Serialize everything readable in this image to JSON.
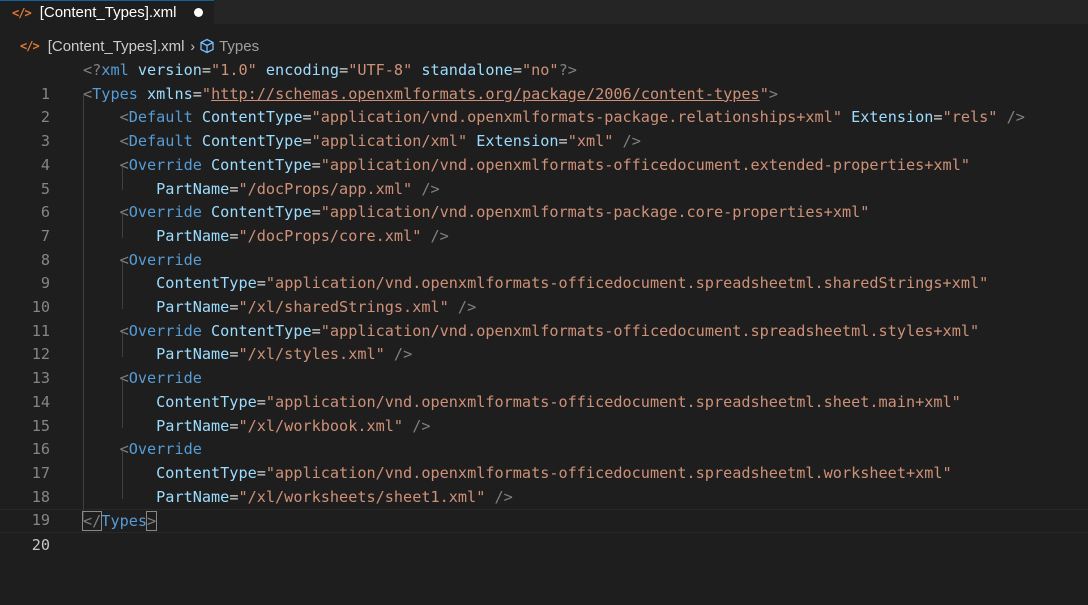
{
  "tab": {
    "icon": "</>",
    "label": "[Content_Types].xml"
  },
  "breadcrumb": {
    "icon": "</>",
    "file": "[Content_Types].xml",
    "chevron": "›",
    "symbol": "Types"
  },
  "editor": {
    "current_line": 20,
    "line_numbers": [
      "1",
      "2",
      "3",
      "4",
      "5",
      "6",
      "7",
      "8",
      "9",
      "10",
      "11",
      "12",
      "13",
      "14",
      "15",
      "16",
      "17",
      "18",
      "19",
      "20"
    ]
  },
  "code": {
    "l1": {
      "open": "<?",
      "tag": "xml",
      "a1": " version",
      "v1": "\"1.0\"",
      "a2": " encoding",
      "v2": "\"UTF-8\"",
      "a3": " standalone",
      "v3": "\"no\"",
      "close": "?>"
    },
    "l2": {
      "open": "<",
      "tag": "Types",
      "a1": " xmlns",
      "v1q1": "\"",
      "v1": "http://schemas.openxmlformats.org/package/2006/content-types",
      "v1q2": "\"",
      "close": ">"
    },
    "l3": {
      "open": "<",
      "tag": "Default",
      "a1": " ContentType",
      "v1": "\"application/vnd.openxmlformats-package.relationships+xml\"",
      "a2": " Extension",
      "v2": "\"rels\"",
      "close": " />"
    },
    "l4": {
      "open": "<",
      "tag": "Default",
      "a1": " ContentType",
      "v1": "\"application/xml\"",
      "a2": " Extension",
      "v2": "\"xml\"",
      "close": " />"
    },
    "l5": {
      "open": "<",
      "tag": "Override",
      "a1": " ContentType",
      "v1": "\"application/vnd.openxmlformats-officedocument.extended-properties+xml\""
    },
    "l6": {
      "a1": "PartName",
      "v1": "\"/docProps/app.xml\"",
      "close": " />"
    },
    "l7": {
      "open": "<",
      "tag": "Override",
      "a1": " ContentType",
      "v1": "\"application/vnd.openxmlformats-package.core-properties+xml\""
    },
    "l8": {
      "a1": "PartName",
      "v1": "\"/docProps/core.xml\"",
      "close": " />"
    },
    "l9": {
      "open": "<",
      "tag": "Override"
    },
    "l10": {
      "a1": "ContentType",
      "v1": "\"application/vnd.openxmlformats-officedocument.spreadsheetml.sharedStrings+xml\""
    },
    "l11": {
      "a1": "PartName",
      "v1": "\"/xl/sharedStrings.xml\"",
      "close": " />"
    },
    "l12": {
      "open": "<",
      "tag": "Override",
      "a1": " ContentType",
      "v1": "\"application/vnd.openxmlformats-officedocument.spreadsheetml.styles+xml\""
    },
    "l13": {
      "a1": "PartName",
      "v1": "\"/xl/styles.xml\"",
      "close": " />"
    },
    "l14": {
      "open": "<",
      "tag": "Override"
    },
    "l15": {
      "a1": "ContentType",
      "v1": "\"application/vnd.openxmlformats-officedocument.spreadsheetml.sheet.main+xml\""
    },
    "l16": {
      "a1": "PartName",
      "v1": "\"/xl/workbook.xml\"",
      "close": " />"
    },
    "l17": {
      "open": "<",
      "tag": "Override"
    },
    "l18": {
      "a1": "ContentType",
      "v1": "\"application/vnd.openxmlformats-officedocument.spreadsheetml.worksheet+xml\""
    },
    "l19": {
      "a1": "PartName",
      "v1": "\"/xl/worksheets/sheet1.xml\"",
      "close": " />"
    },
    "l20": {
      "open": "</",
      "tag": "Types",
      "close": ">"
    }
  }
}
